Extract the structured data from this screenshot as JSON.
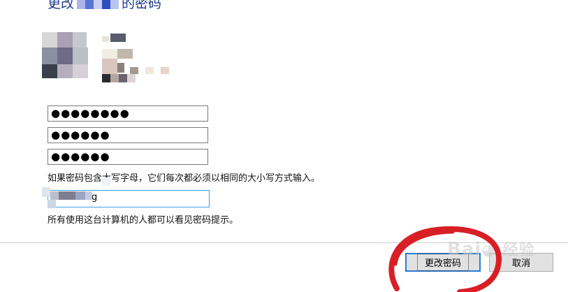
{
  "dialog": {
    "title_prefix": "更改",
    "title_suffix": "的密码"
  },
  "fields": {
    "current_password": "●●●●●●●●",
    "new_password": "●●●●●●",
    "confirm_password": "●●●●●●",
    "hint_value": "g"
  },
  "text": {
    "case_notice": "如果密码包含大写字母，它们每次都必须以相同的大小写方式输入。",
    "hint_notice": "所有使用这台计算机的人都可以看见密码提示。"
  },
  "buttons": {
    "change_password": "更改密码",
    "cancel": "取消"
  },
  "watermark": "Baidu经验",
  "colors": {
    "title": "#1f3a8a",
    "focus_border": "#3a9ee0",
    "primary_border": "#2b7cd3",
    "annotation": "#d81f26"
  }
}
